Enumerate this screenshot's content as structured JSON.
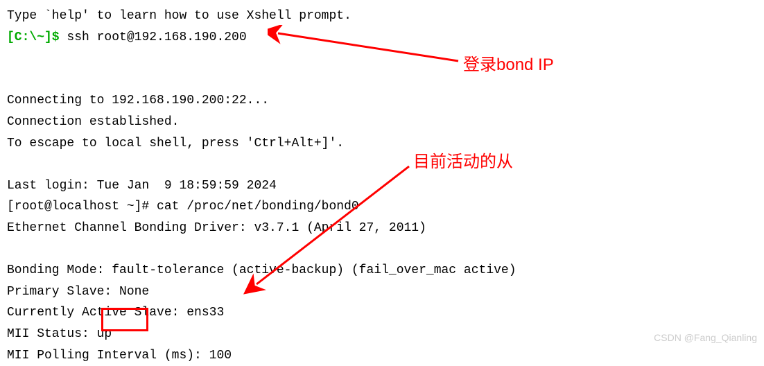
{
  "terminal": {
    "help_line": "Type `help' to learn how to use Xshell prompt.",
    "prompt_prefix": "[C:\\~]$ ",
    "ssh_command": "ssh root@192.168.190.200",
    "connecting": "Connecting to 192.168.190.200:22...",
    "established": "Connection established.",
    "escape": "To escape to local shell, press 'Ctrl+Alt+]'.",
    "last_login": "Last login: Tue Jan  9 18:59:59 2024",
    "root_prompt": "[root@localhost ~]# cat /proc/net/bonding/bond0",
    "driver": "Ethernet Channel Bonding Driver: v3.7.1 (April 27, 2011)",
    "bonding_mode": "Bonding Mode: fault-tolerance (active-backup) (fail_over_mac active)",
    "primary_slave": "Primary Slave: None",
    "active_slave": "Currently Active Slave: ens33",
    "mii_status": "MII Status: up",
    "mii_polling": "MII Polling Interval (ms): 100"
  },
  "annotations": {
    "label1": "登录bond IP",
    "label2": "目前活动的从"
  },
  "watermark": "CSDN @Fang_Qianling"
}
